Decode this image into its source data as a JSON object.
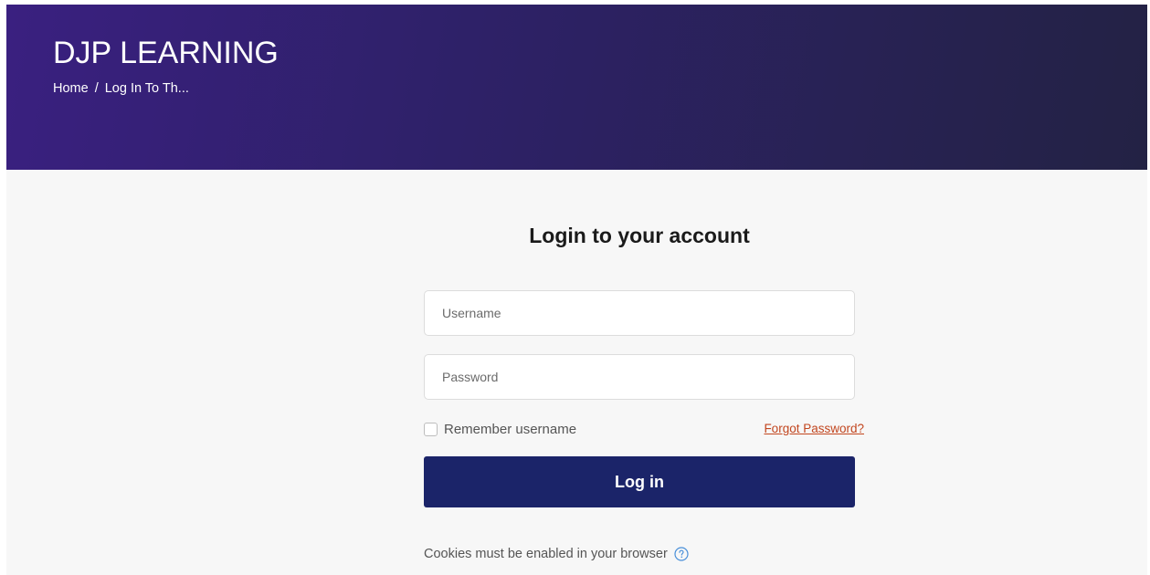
{
  "header": {
    "site_title": "DJP LEARNING",
    "breadcrumb": [
      {
        "label": "Home"
      },
      {
        "label": "Log In To Th..."
      }
    ],
    "breadcrumb_separator": "/"
  },
  "login": {
    "title": "Login to your account",
    "username": {
      "value": "",
      "placeholder": "Username"
    },
    "password": {
      "value": "",
      "placeholder": "Password"
    },
    "remember_label": "Remember username",
    "remember_checked": false,
    "forgot_label": "Forgot Password?",
    "submit_label": "Log in",
    "cookies_notice": "Cookies must be enabled in your browser",
    "help_icon": "question-circle-icon"
  },
  "colors": {
    "header_gradient_start": "#3a2080",
    "header_gradient_end": "#232244",
    "button_bg": "#1b2469",
    "link": "#c2461f",
    "help_icon": "#4a90d9"
  }
}
